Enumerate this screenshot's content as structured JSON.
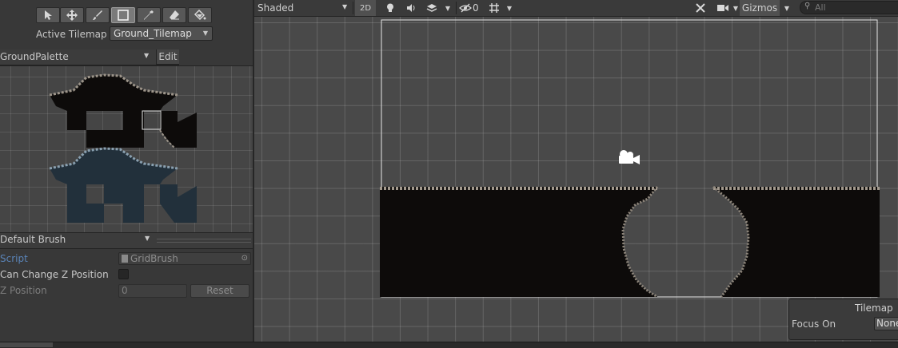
{
  "tile_palette": {
    "active_tilemap_label": "Active Tilemap",
    "active_tilemap_value": "Ground_Tilemap",
    "palette_name": "GroundPalette",
    "edit_label": "Edit",
    "tools": [
      "select-tool",
      "move-tool",
      "paint-brush-tool",
      "box-fill-tool",
      "pick-tool",
      "erase-tool",
      "flood-fill-tool"
    ],
    "active_tool": "box-fill-tool"
  },
  "brush_inspector": {
    "brush_name": "Default Brush",
    "script_label": "Script",
    "script_value": "GridBrush",
    "can_change_z_label": "Can Change Z Position",
    "can_change_z": false,
    "z_position_label": "Z Position",
    "z_position_value": "0",
    "reset_label": "Reset"
  },
  "scene_toolbar": {
    "shading_mode": "Shaded",
    "mode_2d": "2D",
    "hidden_count": "0",
    "gizmos_label": "Gizmos",
    "search_placeholder": "All"
  },
  "tilemap_overlay": {
    "title": "Tilemap",
    "focus_on_label": "Focus On",
    "focus_on_value": "None"
  },
  "colors": {
    "panel_bg": "#383838",
    "scene_bg": "#494949",
    "terrain_fill": "#0d0b0a",
    "terrain_edge": "#a39a8e",
    "link_text": "#5a84b8"
  }
}
